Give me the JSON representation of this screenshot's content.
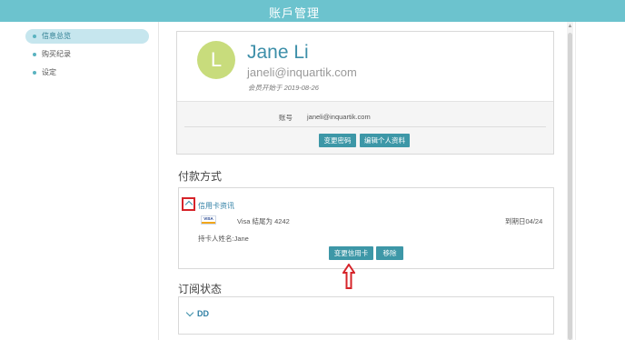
{
  "header": {
    "title": "账戶管理"
  },
  "sidebar": {
    "items": [
      {
        "label": "信息总览",
        "active": true
      },
      {
        "label": "购买纪录",
        "active": false
      },
      {
        "label": "设定",
        "active": false
      }
    ]
  },
  "profile": {
    "avatar_letter": "L",
    "name": "Jane Li",
    "email": "janeli@inquartik.com",
    "member_since": "会员开始于 2019-08-26",
    "account_label": "账号",
    "account_value": "janeli@inquartik.com",
    "change_password_label": "变更密码",
    "edit_profile_label": "编辑个人资料"
  },
  "payment": {
    "section_title": "付款方式",
    "card_section_title": "信用卡资讯",
    "card_brand": "VISA",
    "card_number": "Visa 結尾为 4242",
    "expiry": "到期日04/24",
    "holder": "持卡人姓名:Jane",
    "change_card_label": "变更信用卡",
    "remove_label": "移除"
  },
  "subscription": {
    "section_title": "订阅状态",
    "item_label": "DD"
  },
  "colors": {
    "header_bg": "#6cc3ce",
    "accent": "#3d97a7",
    "link": "#2f7fa4",
    "highlight_red": "#d6242a",
    "avatar_bg": "#c8dc7c"
  }
}
